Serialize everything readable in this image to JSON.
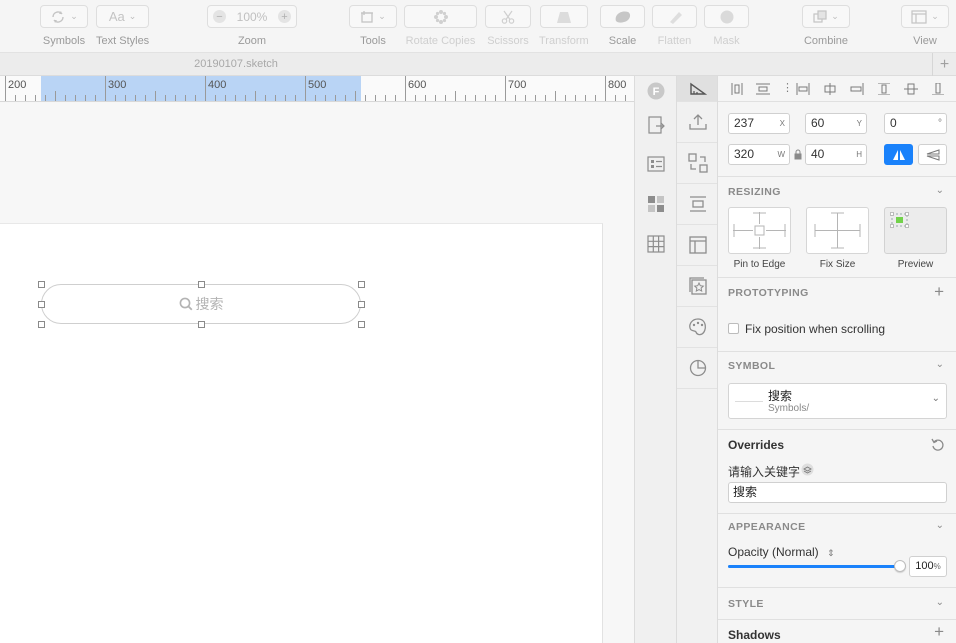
{
  "toolbar": {
    "symbols_label": "Symbols",
    "text_styles_label": "Text Styles",
    "text_styles_glyph": "Aa",
    "zoom_label": "Zoom",
    "zoom_value": "100%",
    "tools_label": "Tools",
    "rotate_copies_label": "Rotate Copies",
    "scissors_label": "Scissors",
    "transform_label": "Transform",
    "scale_label": "Scale",
    "flatten_label": "Flatten",
    "mask_label": "Mask",
    "combine_label": "Combine",
    "view_label": "View"
  },
  "tabbar": {
    "document_title": "20190107.sketch"
  },
  "ruler": {
    "labels": [
      "200",
      "300",
      "400",
      "500",
      "600",
      "700",
      "800"
    ]
  },
  "canvas": {
    "search_placeholder": "搜索"
  },
  "inspector": {
    "position": {
      "x": "237",
      "y": "60",
      "rotation": "0",
      "x_label": "X",
      "y_label": "Y",
      "rotation_unit": "°"
    },
    "size": {
      "w": "320",
      "h": "40",
      "w_label": "W",
      "h_label": "H"
    },
    "resizing": {
      "title": "RESIZING",
      "pin_to_edge": "Pin to Edge",
      "fix_size": "Fix Size",
      "preview": "Preview"
    },
    "prototyping": {
      "title": "PROTOTYPING",
      "fix_position": "Fix position when scrolling"
    },
    "symbol": {
      "title": "SYMBOL",
      "name": "搜索",
      "path": "Symbols/"
    },
    "overrides": {
      "title": "Overrides",
      "field_label": "请输入关键字",
      "field_value": "搜索"
    },
    "appearance": {
      "title": "APPEARANCE",
      "opacity_label": "Opacity (Normal)",
      "opacity_value": "100",
      "opacity_unit": "%",
      "opacity_fraction": 1.0
    },
    "style": {
      "title": "STYLE",
      "shadows": "Shadows"
    }
  },
  "colors": {
    "accent": "#1a82fb",
    "selection": "#b9d4f5"
  }
}
